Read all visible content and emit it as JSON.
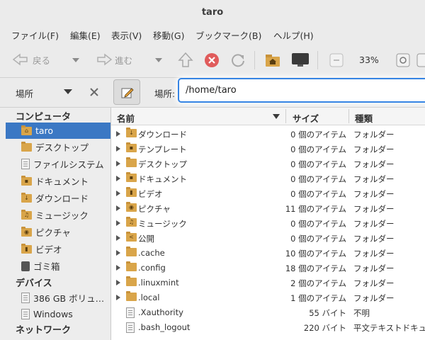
{
  "window": {
    "title": "taro"
  },
  "menu": [
    "ファイル(F)",
    "編集(E)",
    "表示(V)",
    "移動(G)",
    "ブックマーク(B)",
    "ヘルプ(H)"
  ],
  "toolbar": {
    "back_label": "戻る",
    "forward_label": "進む",
    "zoom": "33%"
  },
  "location": {
    "sidebar_mode": "場所",
    "label": "場所:",
    "path": "/home/taro"
  },
  "sidebar": {
    "section_computer": "コンピュータ",
    "section_devices": "デバイス",
    "section_network": "ネットワーク",
    "computer_items": [
      {
        "label": "taro",
        "icon": "home-folder-icon"
      },
      {
        "label": "デスクトップ",
        "icon": "folder-icon"
      },
      {
        "label": "ファイルシステム",
        "icon": "drive-icon"
      },
      {
        "label": "ドキュメント",
        "icon": "documents-folder-icon"
      },
      {
        "label": "ダウンロード",
        "icon": "downloads-folder-icon"
      },
      {
        "label": "ミュージック",
        "icon": "music-folder-icon"
      },
      {
        "label": "ピクチャ",
        "icon": "pictures-folder-icon"
      },
      {
        "label": "ビデオ",
        "icon": "videos-folder-icon"
      },
      {
        "label": "ゴミ箱",
        "icon": "trash-icon"
      }
    ],
    "device_items": [
      {
        "label": "386 GB ボリュ…",
        "icon": "drive-icon"
      },
      {
        "label": "Windows",
        "icon": "drive-icon"
      }
    ]
  },
  "columns": {
    "name": "名前",
    "size": "サイズ",
    "type": "種類"
  },
  "files": [
    {
      "name": "ダウンロード",
      "size": "0 個のアイテム",
      "type": "フォルダー",
      "icon": "downloads-folder-icon"
    },
    {
      "name": "テンプレート",
      "size": "0 個のアイテム",
      "type": "フォルダー",
      "icon": "templates-folder-icon"
    },
    {
      "name": "デスクトップ",
      "size": "0 個のアイテム",
      "type": "フォルダー",
      "icon": "folder-icon"
    },
    {
      "name": "ドキュメント",
      "size": "0 個のアイテム",
      "type": "フォルダー",
      "icon": "documents-folder-icon"
    },
    {
      "name": "ビデオ",
      "size": "0 個のアイテム",
      "type": "フォルダー",
      "icon": "videos-folder-icon"
    },
    {
      "name": "ピクチャ",
      "size": "11 個のアイテム",
      "type": "フォルダー",
      "icon": "pictures-folder-icon"
    },
    {
      "name": "ミュージック",
      "size": "0 個のアイテム",
      "type": "フォルダー",
      "icon": "music-folder-icon"
    },
    {
      "name": "公開",
      "size": "0 個のアイテム",
      "type": "フォルダー",
      "icon": "public-folder-icon"
    },
    {
      "name": ".cache",
      "size": "10 個のアイテム",
      "type": "フォルダー",
      "icon": "folder-icon"
    },
    {
      "name": ".config",
      "size": "18 個のアイテム",
      "type": "フォルダー",
      "icon": "folder-icon"
    },
    {
      "name": ".linuxmint",
      "size": "2 個のアイテム",
      "type": "フォルダー",
      "icon": "folder-icon"
    },
    {
      "name": ".local",
      "size": "1 個のアイテム",
      "type": "フォルダー",
      "icon": "folder-icon"
    },
    {
      "name": ".Xauthority",
      "size": "55 バイト",
      "type": "不明",
      "icon": "unknown-file-icon"
    },
    {
      "name": ".bash_logout",
      "size": "220 バイト",
      "type": "平文テキストドキュ…",
      "icon": "text-file-icon"
    }
  ],
  "colors": {
    "selection": "#3b78c4",
    "focus": "#3584e4",
    "folder": "#d9a54a"
  }
}
